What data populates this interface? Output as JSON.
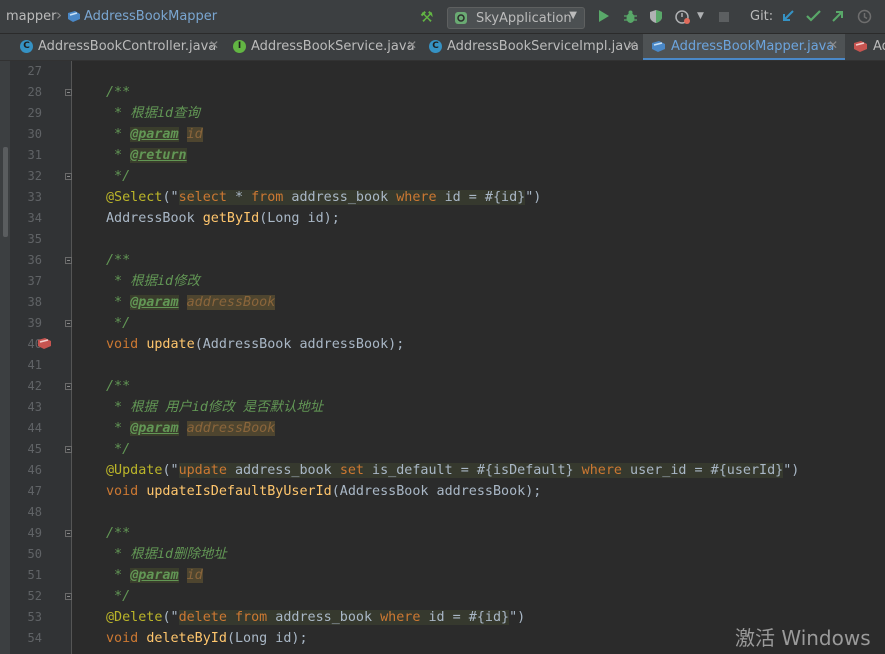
{
  "breadcrumb": {
    "folder": "mapper",
    "file": "AddressBookMapper"
  },
  "run_config": {
    "label": "SkyApplication"
  },
  "vcs": {
    "label": "Git:"
  },
  "tabs": [
    {
      "label": "AddressBookController.java",
      "icon_letter": "C",
      "icon_color": "#3592c4",
      "active": false
    },
    {
      "label": "AddressBookService.java",
      "icon_letter": "I",
      "icon_color": "#62b543",
      "active": false
    },
    {
      "label": "AddressBookServiceImpl.java",
      "icon_letter": "C",
      "icon_color": "#3592c4",
      "active": false
    },
    {
      "label": "AddressBookMapper.java",
      "icon_letter": "",
      "icon_color": "#4a88c7",
      "active": true
    },
    {
      "label": "Ad",
      "icon_letter": "",
      "icon_color": "#c75450",
      "active": false
    }
  ],
  "line_numbers": [
    "27",
    "28",
    "29",
    "30",
    "31",
    "32",
    "33",
    "34",
    "35",
    "36",
    "37",
    "38",
    "39",
    "40",
    "41",
    "42",
    "43",
    "44",
    "45",
    "46",
    "47",
    "48",
    "49",
    "50",
    "51",
    "52",
    "53",
    "54"
  ],
  "code": {
    "l28": "/**",
    "l29": " * 根据id查询",
    "l30_star": " * ",
    "l30_tag": "@param",
    "l30_param": "id",
    "l31_star": " * ",
    "l31_tag": "@return",
    "l32": " */",
    "l33_anno": "@Select",
    "l33_open": "(\"",
    "l33_kw1": "select",
    "l33_s1": " * ",
    "l33_kw2": "from",
    "l33_s2": " address_book ",
    "l33_kw3": "where",
    "l33_s3": " id = #{id}",
    "l33_close": "\")",
    "l34_type": "AddressBook ",
    "l34_fn": "getById",
    "l34_rest": "(Long id);",
    "l36": "/**",
    "l37": " * 根据id修改",
    "l38_star": " * ",
    "l38_tag": "@param",
    "l38_param": "addressBook",
    "l39": " */",
    "l40_kw": "void ",
    "l40_fn": "update",
    "l40_rest": "(AddressBook addressBook);",
    "l42": "/**",
    "l43": " * 根据 用户id修改 是否默认地址",
    "l44_star": " * ",
    "l44_tag": "@param",
    "l44_param": "addressBook",
    "l45": " */",
    "l46_anno": "@Update",
    "l46_open": "(\"",
    "l46_kw1": "update",
    "l46_s1": " address_book ",
    "l46_kw2": "set",
    "l46_s2": " is_default = #{isDefault} ",
    "l46_kw3": "where",
    "l46_s3": " user_id = #{userId}",
    "l46_close": "\")",
    "l47_kw": "void ",
    "l47_fn": "updateIsDefaultByUserId",
    "l47_rest": "(AddressBook addressBook);",
    "l49": "/**",
    "l50": " * 根据id删除地址",
    "l51_star": " * ",
    "l51_tag": "@param",
    "l51_param": "id",
    "l52": " */",
    "l53_anno": "@Delete",
    "l53_open": "(\"",
    "l53_kw1": "delete",
    "l53_s1": " ",
    "l53_kw2": "from",
    "l53_s2": " address_book ",
    "l53_kw3": "where",
    "l53_s3": " id = #{id}",
    "l53_close": "\")",
    "l54_kw": "void ",
    "l54_fn": "deleteById",
    "l54_rest": "(Long id);"
  },
  "watermark": "激活 Windows",
  "colors": {
    "keyword": "#cc7832",
    "comment": "#629755",
    "function": "#ffc66d",
    "annotation": "#bbb529",
    "plain": "#a9b7c6",
    "accent": "#4a88c7"
  }
}
